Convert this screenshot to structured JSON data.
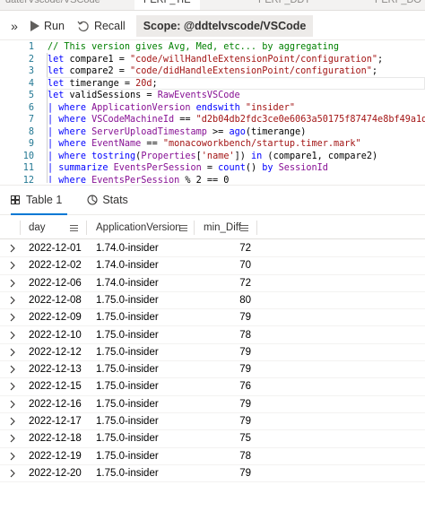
{
  "doc_tabs": [
    {
      "label": "daterVscode/VSCode",
      "active": false
    },
    {
      "label": "PERF_TIE",
      "active": true
    },
    {
      "label": "PERF_DDT",
      "active": false
    },
    {
      "label": "PERF_DO",
      "active": false
    }
  ],
  "toolbar": {
    "expand_label": "»",
    "run_label": "Run",
    "recall_label": "Recall",
    "scope_label": "Scope: @ddtelvscode/VSCode"
  },
  "editor": {
    "line_numbers": [
      "1",
      "2",
      "3",
      "4",
      "5",
      "6",
      "7",
      "8",
      "9",
      "10",
      "11",
      "12"
    ]
  },
  "results": {
    "tab_table_label": "Table 1",
    "tab_stats_label": "Stats",
    "columns": [
      "day",
      "ApplicationVersion",
      "min_Diff"
    ],
    "rows": [
      {
        "day": "2022-12-01",
        "version": "1.74.0-insider",
        "min_diff": "72"
      },
      {
        "day": "2022-12-02",
        "version": "1.74.0-insider",
        "min_diff": "70"
      },
      {
        "day": "2022-12-06",
        "version": "1.74.0-insider",
        "min_diff": "72"
      },
      {
        "day": "2022-12-08",
        "version": "1.75.0-insider",
        "min_diff": "80"
      },
      {
        "day": "2022-12-09",
        "version": "1.75.0-insider",
        "min_diff": "79"
      },
      {
        "day": "2022-12-10",
        "version": "1.75.0-insider",
        "min_diff": "78"
      },
      {
        "day": "2022-12-12",
        "version": "1.75.0-insider",
        "min_diff": "79"
      },
      {
        "day": "2022-12-13",
        "version": "1.75.0-insider",
        "min_diff": "79"
      },
      {
        "day": "2022-12-15",
        "version": "1.75.0-insider",
        "min_diff": "76"
      },
      {
        "day": "2022-12-16",
        "version": "1.75.0-insider",
        "min_diff": "79"
      },
      {
        "day": "2022-12-17",
        "version": "1.75.0-insider",
        "min_diff": "79"
      },
      {
        "day": "2022-12-18",
        "version": "1.75.0-insider",
        "min_diff": "75"
      },
      {
        "day": "2022-12-19",
        "version": "1.75.0-insider",
        "min_diff": "78"
      },
      {
        "day": "2022-12-20",
        "version": "1.75.0-insider",
        "min_diff": "79"
      }
    ]
  },
  "colors": {
    "accent": "#0078d4",
    "keyword": "#0000ff",
    "string": "#a31515",
    "comment": "#008000",
    "table_name": "#871094",
    "line_number": "#237893"
  },
  "icons": [
    "expand-icon",
    "play-icon",
    "recall-icon",
    "table-grid-icon",
    "stats-icon",
    "column-menu-icon",
    "chevron-right-icon"
  ]
}
